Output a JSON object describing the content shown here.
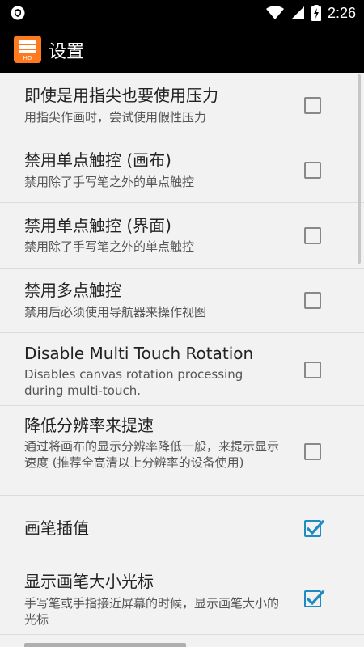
{
  "status_bar": {
    "time": "2:26",
    "icons": [
      "shield-icon",
      "wifi-icon",
      "signal-icon",
      "battery-charging-icon"
    ]
  },
  "app_bar": {
    "title": "设置",
    "icon_label": "HD",
    "icon_color": "#ff7a1e"
  },
  "settings": {
    "items": [
      {
        "title": "即使是用指尖也要使用压力",
        "summary": "用指尖作画时，尝试使用假性压力",
        "checked": false
      },
      {
        "title": "禁用单点触控 (画布)",
        "summary": "禁用除了手写笔之外的单点触控",
        "checked": false
      },
      {
        "title": "禁用单点触控 (界面)",
        "summary": "禁用除了手写笔之外的单点触控",
        "checked": false
      },
      {
        "title": "禁用多点触控",
        "summary": "禁用后必须使用导航器来操作视图",
        "checked": false
      },
      {
        "title": "Disable Multi Touch Rotation",
        "summary": "Disables canvas rotation processing during multi-touch.",
        "checked": false
      },
      {
        "title": "降低分辨率来提速",
        "summary": "通过将画布的显示分辨率降低一般，来提示显示速度 (推荐全高清以上分辨率的设备使用)",
        "checked": false
      },
      {
        "title": "画笔插值",
        "summary": "",
        "checked": true
      },
      {
        "title": "显示画笔大小光标",
        "summary": "手写笔或手指接近屏幕的时候，显示画笔大小的光标",
        "checked": true
      }
    ]
  },
  "colors": {
    "checkbox_checked": "#1e8bc3",
    "checkbox_unchecked": "#888888"
  }
}
